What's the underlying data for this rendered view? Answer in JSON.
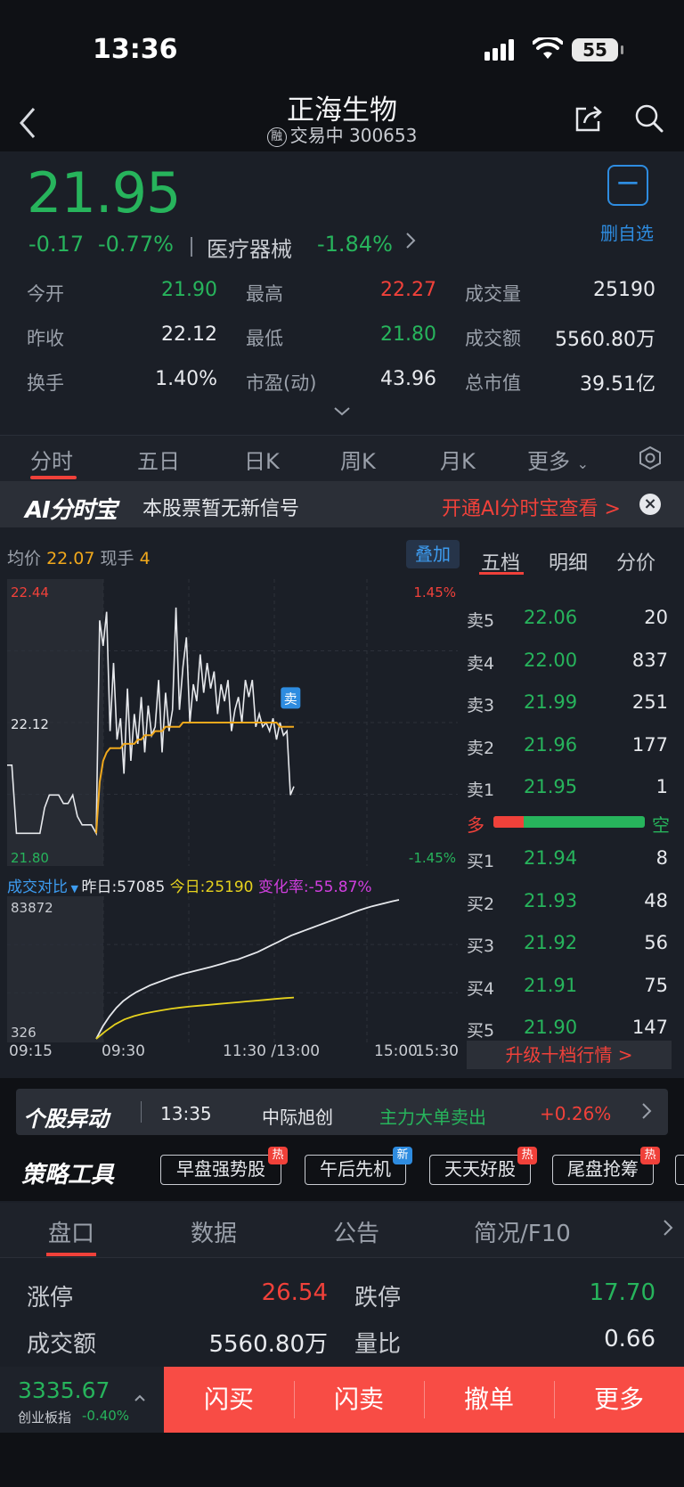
{
  "status": {
    "time": "13:36",
    "battery": "55"
  },
  "header": {
    "title": "正海生物",
    "margin_badge": "融",
    "status": "交易中",
    "code": "300653"
  },
  "quote": {
    "price": "21.95",
    "change": "-0.17",
    "change_pct": "-0.77%",
    "sector": "医疗器械",
    "sector_pct": "-1.84%",
    "watch_label": "删自选",
    "stats": [
      {
        "label": "今开",
        "value": "21.90",
        "color": "green"
      },
      {
        "label": "最高",
        "value": "22.27",
        "color": "red"
      },
      {
        "label": "成交量",
        "value": "25190",
        "color": "white"
      },
      {
        "label": "昨收",
        "value": "22.12",
        "color": "white"
      },
      {
        "label": "最低",
        "value": "21.80",
        "color": "green"
      },
      {
        "label": "成交额",
        "value": "5560.80万",
        "color": "white"
      },
      {
        "label": "换手",
        "value": "1.40%",
        "color": "white"
      },
      {
        "label": "市盈(动)",
        "value": "43.96",
        "color": "white"
      },
      {
        "label": "总市值",
        "value": "39.51亿",
        "color": "white"
      }
    ]
  },
  "chart_tabs": [
    "分时",
    "五日",
    "日K",
    "周K",
    "月K",
    "更多"
  ],
  "ai_banner": {
    "logo": "AI分时宝",
    "text": "本股票暂无新信号",
    "link": "开通AI分时宝查看 >",
    "close": "×"
  },
  "chart_header": {
    "avg_label": "均价",
    "avg_value": "22.07",
    "hand_label": "现手",
    "hand_value": "4",
    "overlay": "叠加"
  },
  "chart_data": {
    "type": "line",
    "y_max": "22.44",
    "y_mid": "22.12",
    "y_min": "21.80",
    "pct_max": "1.45%",
    "pct_min": "-1.45%",
    "price_range": [
      21.8,
      22.44
    ],
    "sell_marker": "卖",
    "price_series": [
      22.02,
      22.02,
      21.86,
      21.86,
      21.86,
      21.86,
      21.86,
      21.86,
      21.92,
      21.95,
      21.95,
      21.95,
      21.93,
      21.93,
      21.95,
      21.9,
      21.88,
      21.88,
      21.88,
      21.86,
      22.36,
      22.3,
      22.38,
      22.1,
      22.26,
      22.08,
      22.13,
      22.0,
      22.2,
      22.03,
      22.14,
      22.07,
      22.18,
      22.05,
      22.16,
      22.09,
      22.11,
      22.22,
      22.05,
      22.19,
      22.1,
      22.15,
      22.39,
      22.15,
      22.25,
      22.32,
      22.12,
      22.21,
      22.17,
      22.28,
      22.19,
      22.26,
      22.2,
      22.24,
      22.14,
      22.21,
      22.17,
      22.22,
      22.1,
      22.15,
      22.18,
      22.12,
      22.22,
      22.18,
      22.22,
      22.11,
      22.14,
      22.11,
      22.12,
      22.1,
      22.13,
      22.08,
      22.12,
      22.09,
      22.1,
      21.95,
      21.97
    ],
    "avg_series": [
      null,
      null,
      null,
      null,
      null,
      null,
      null,
      null,
      null,
      null,
      null,
      null,
      null,
      null,
      null,
      null,
      null,
      null,
      null,
      21.86,
      21.98,
      22.03,
      22.05,
      22.06,
      22.06,
      22.06,
      22.06,
      22.07,
      22.07,
      22.07,
      22.07,
      22.08,
      22.08,
      22.09,
      22.09,
      22.09,
      22.1,
      22.1,
      22.1,
      22.11,
      22.11,
      22.11,
      22.11,
      22.11,
      22.12,
      22.12,
      22.12,
      22.12,
      22.12,
      22.12,
      22.12,
      22.12,
      22.12,
      22.12,
      22.12,
      22.12,
      22.12,
      22.12,
      22.12,
      22.12,
      22.12,
      22.12,
      22.12,
      22.12,
      22.12,
      22.12,
      22.12,
      22.12,
      22.12,
      22.12,
      22.12,
      22.12,
      22.11,
      22.11,
      22.11,
      22.11,
      22.11
    ],
    "vol_header": {
      "label": "成交对比",
      "yesterday": "昨日:57085",
      "today": "今日:25190",
      "change": "变化率:-55.87%"
    },
    "vol_max": "83872",
    "vol_min": "326",
    "vol_range": [
      326,
      83872
    ],
    "vol_yesterday": [
      326,
      8000,
      14000,
      19000,
      23000,
      26000,
      28500,
      30500,
      32500,
      34000,
      35500,
      37000,
      38300,
      39500,
      40500,
      41500,
      42500,
      43500,
      44600,
      45800,
      47000,
      48000,
      49500,
      51000,
      52500,
      54500,
      56500,
      58500,
      60500,
      62500,
      64000,
      65500,
      67000,
      68500,
      70000,
      71500,
      73000,
      74500,
      76000,
      77500,
      78800,
      80000,
      81000,
      82000,
      83000,
      83872
    ],
    "vol_today": [
      326,
      5000,
      9000,
      12000,
      14000,
      15500,
      16500,
      17500,
      18500,
      19200,
      19800,
      20300,
      20800,
      21300,
      21800,
      22300,
      22800,
      23300,
      23800,
      24300,
      24800,
      25190
    ],
    "time_labels": [
      "09:15",
      "09:30",
      "11:30 /13:00",
      "15:00",
      "15:30"
    ]
  },
  "order_book": {
    "tabs": [
      "五档",
      "明细",
      "分价"
    ],
    "asks": [
      {
        "label": "卖5",
        "price": "22.06",
        "qty": "20"
      },
      {
        "label": "卖4",
        "price": "22.00",
        "qty": "837"
      },
      {
        "label": "卖3",
        "price": "21.99",
        "qty": "251"
      },
      {
        "label": "卖2",
        "price": "21.96",
        "qty": "177"
      },
      {
        "label": "卖1",
        "price": "21.95",
        "qty": "1"
      }
    ],
    "bull_label": "多",
    "bear_label": "空",
    "bull_ratio": 0.2,
    "bids": [
      {
        "label": "买1",
        "price": "21.94",
        "qty": "8"
      },
      {
        "label": "买2",
        "price": "21.93",
        "qty": "48"
      },
      {
        "label": "买3",
        "price": "21.92",
        "qty": "56"
      },
      {
        "label": "买4",
        "price": "21.91",
        "qty": "75"
      },
      {
        "label": "买5",
        "price": "21.90",
        "qty": "147"
      }
    ],
    "upgrade": "升级十档行情 >"
  },
  "movement": {
    "logo": "个股异动",
    "time": "13:35",
    "stock": "中际旭创",
    "signal": "主力大单卖出",
    "pct": "+0.26%"
  },
  "strategy": {
    "logo": "策略工具",
    "chips": [
      {
        "label": "早盘强势股",
        "badge": "热",
        "badge_color": "#f0413a"
      },
      {
        "label": "午后先机",
        "badge": "新",
        "badge_color": "#2e8ce0"
      },
      {
        "label": "天天好股",
        "badge": "热",
        "badge_color": "#f0413a"
      },
      {
        "label": "尾盘抢筹",
        "badge": "热",
        "badge_color": "#f0413a"
      }
    ]
  },
  "bottom_tabs": [
    "盘口",
    "数据",
    "公告",
    "简况/F10"
  ],
  "limits": {
    "up_label": "涨停",
    "up_value": "26.54",
    "down_label": "跌停",
    "down_value": "17.70",
    "amount_label": "成交额",
    "amount_value": "5560.80万",
    "ratio_label": "量比",
    "ratio_value": "0.66"
  },
  "footer": {
    "index_value": "3335.67",
    "index_name": "创业板指",
    "index_pct": "-0.40%",
    "actions": [
      "闪买",
      "闪卖",
      "撤单",
      "更多"
    ]
  },
  "colors": {
    "up": "#f0413a",
    "down": "#27b45c",
    "accent": "#2e8ce0",
    "avg_line": "#f0a81c",
    "vol_today": "#e6d21e"
  }
}
